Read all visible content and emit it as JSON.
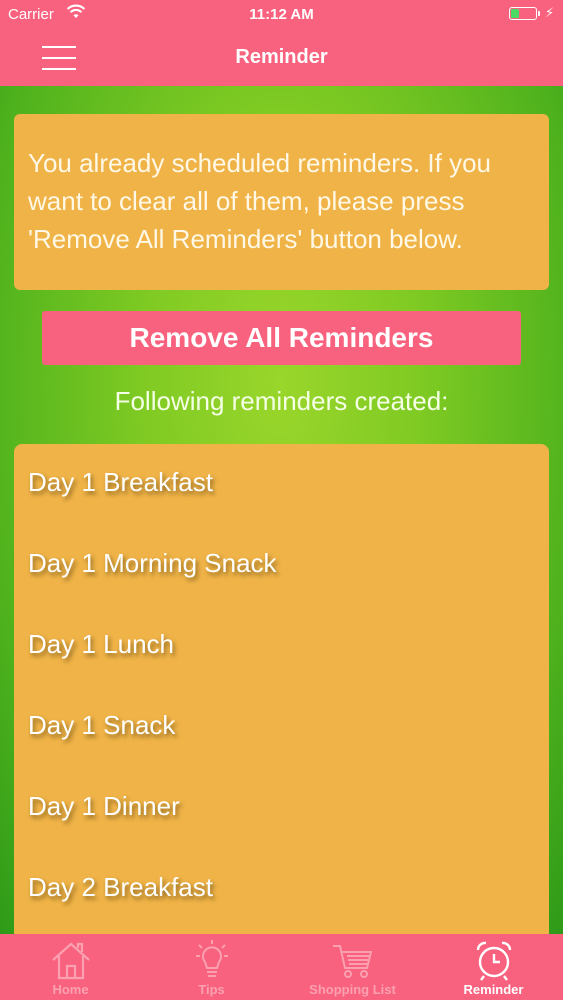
{
  "status_bar": {
    "carrier": "Carrier",
    "time": "11:12 AM"
  },
  "nav": {
    "title": "Reminder"
  },
  "info": {
    "text": "You already scheduled reminders. If you want to clear all of them, please press 'Remove All Reminders' button below."
  },
  "remove_button": {
    "label": "Remove All Reminders"
  },
  "list_heading": "Following reminders created:",
  "reminders": [
    "Day 1 Breakfast",
    "Day 1 Morning Snack",
    "Day 1 Lunch",
    "Day 1 Snack",
    "Day 1 Dinner",
    "Day 2 Breakfast"
  ],
  "tabs": [
    {
      "label": "Home",
      "icon": "home-icon",
      "active": false
    },
    {
      "label": "Tips",
      "icon": "lightbulb-icon",
      "active": false
    },
    {
      "label": "Shopping List",
      "icon": "cart-icon",
      "active": false
    },
    {
      "label": "Reminder",
      "icon": "alarm-clock-icon",
      "active": true
    }
  ],
  "colors": {
    "accent": "#f8627e",
    "card": "#efb347",
    "background": "#6fc21f"
  }
}
